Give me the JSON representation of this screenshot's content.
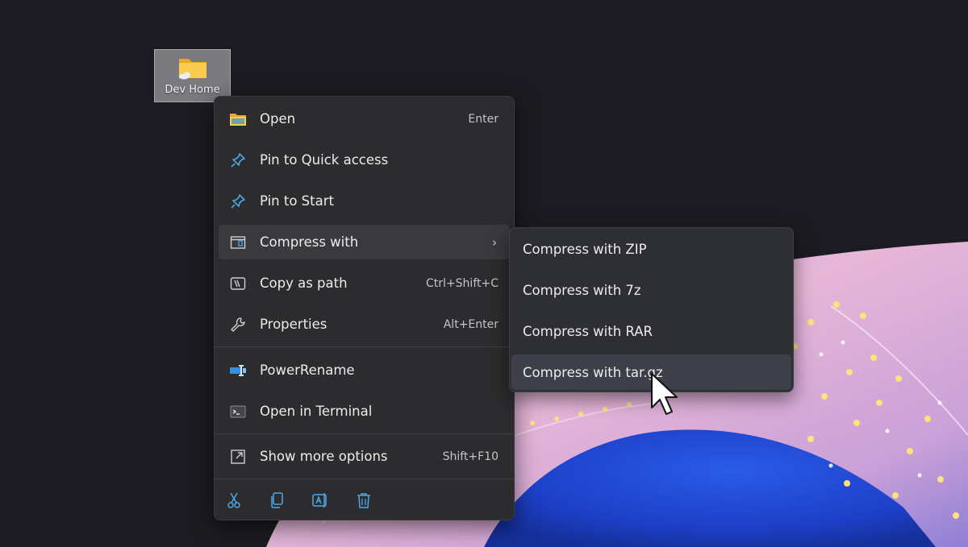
{
  "desktop": {
    "icon": {
      "label": "Dev Home",
      "icon": "folder-cloud-icon"
    }
  },
  "context_menu": {
    "items": [
      {
        "label": "Open",
        "shortcut": "Enter",
        "icon": "folder-open-icon"
      },
      {
        "label": "Pin to Quick access",
        "shortcut": "",
        "icon": "pin-icon"
      },
      {
        "label": "Pin to Start",
        "shortcut": "",
        "icon": "pin-icon"
      },
      {
        "label": "Compress with",
        "shortcut": "",
        "icon": "archive-icon",
        "submenu": true
      },
      {
        "label": "Copy as path",
        "shortcut": "Ctrl+Shift+C",
        "icon": "copy-path-icon"
      },
      {
        "label": "Properties",
        "shortcut": "Alt+Enter",
        "icon": "wrench-icon"
      },
      {
        "label": "PowerRename",
        "shortcut": "",
        "icon": "powerrename-icon"
      },
      {
        "label": "Open in Terminal",
        "shortcut": "",
        "icon": "terminal-icon"
      },
      {
        "label": "Show more options",
        "shortcut": "Shift+F10",
        "icon": "more-options-icon"
      }
    ],
    "toolbar": [
      {
        "icon": "cut-icon"
      },
      {
        "icon": "copy-icon"
      },
      {
        "icon": "rename-icon"
      },
      {
        "icon": "delete-icon"
      }
    ]
  },
  "submenu": {
    "items": [
      {
        "label": "Compress with ZIP"
      },
      {
        "label": "Compress with 7z"
      },
      {
        "label": "Compress with RAR"
      },
      {
        "label": "Compress with tar.gz"
      }
    ]
  },
  "colors": {
    "background": "#1b1b21",
    "menu_bg": "#2c2c2e",
    "accent_blue": "#4ea7e6",
    "folder_yellow": "#f5c342"
  }
}
